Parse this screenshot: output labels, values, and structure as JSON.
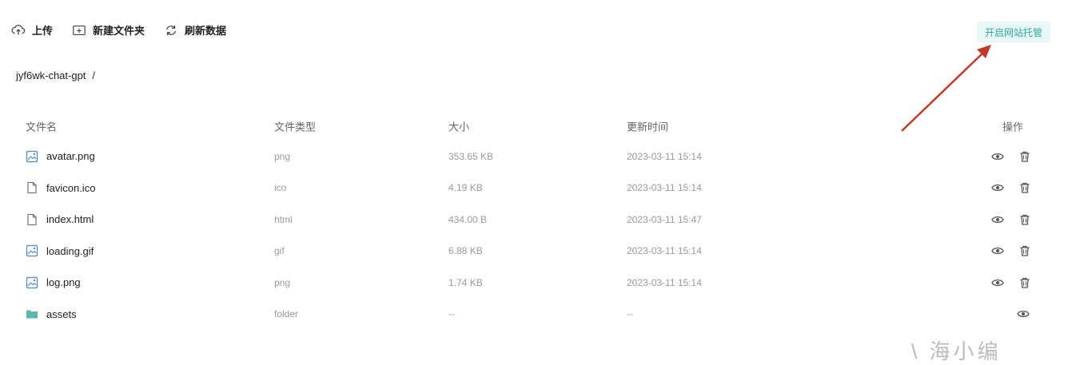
{
  "toolbar": {
    "upload_label": "上传",
    "new_folder_label": "新建文件夹",
    "refresh_label": "刷新数据"
  },
  "host_button_label": "开启网站托管",
  "breadcrumb": {
    "folder": "jyf6wk-chat-gpt",
    "separator": "/"
  },
  "table": {
    "headers": {
      "name": "文件名",
      "type": "文件类型",
      "size": "大小",
      "time": "更新时间",
      "ops": "操作"
    },
    "rows": [
      {
        "name": "avatar.png",
        "type": "png",
        "size": "353.65 KB",
        "time": "2023-03-11 15:14",
        "icon": "image-file-icon"
      },
      {
        "name": "favicon.ico",
        "type": "ico",
        "size": "4.19 KB",
        "time": "2023-03-11 15:14",
        "icon": "file-icon"
      },
      {
        "name": "index.html",
        "type": "html",
        "size": "434.00 B",
        "time": "2023-03-11 15:47",
        "icon": "file-icon"
      },
      {
        "name": "loading.gif",
        "type": "gif",
        "size": "6.88 KB",
        "time": "2023-03-11 15:14",
        "icon": "image-file-icon"
      },
      {
        "name": "log.png",
        "type": "png",
        "size": "1.74 KB",
        "time": "2023-03-11 15:14",
        "icon": "image-file-icon"
      },
      {
        "name": "assets",
        "type": "folder",
        "size": "--",
        "time": "--",
        "icon": "folder-icon"
      }
    ]
  },
  "watermark": "\\ 海小编",
  "colors": {
    "accent": "#33a7a0",
    "accent_bg": "#e8f7f6",
    "arrow": "#c0392b",
    "icon": "#4a8ac4",
    "folder": "#5bb7b2"
  }
}
